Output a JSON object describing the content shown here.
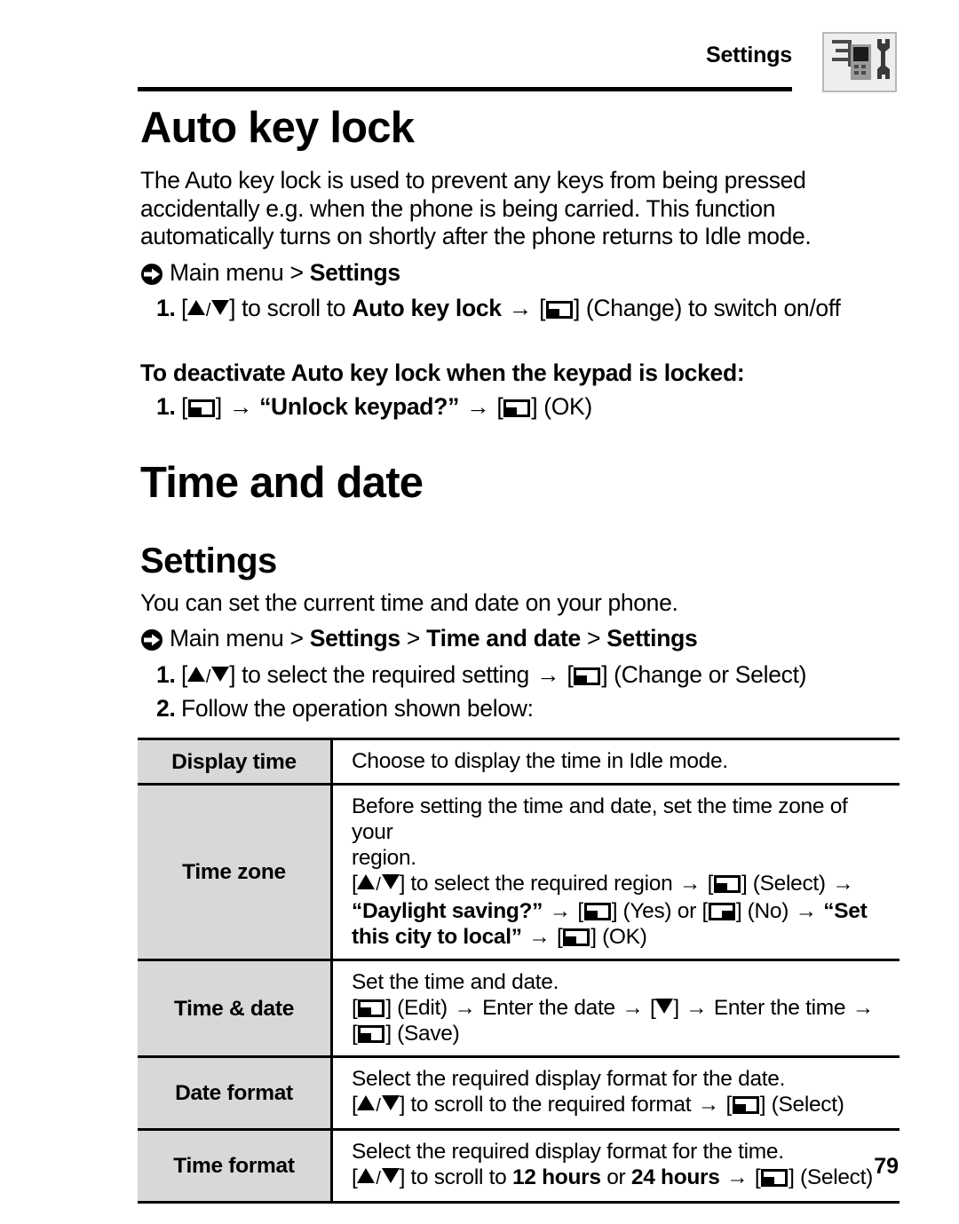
{
  "running_head": {
    "title": "Settings",
    "chapter_icon": "settings-tools-icon"
  },
  "sections": [
    {
      "heading": "Auto key lock",
      "intro": "The Auto key lock is used to prevent any keys from being pressed accidentally e.g. when the phone is being carried. This function automatically turns on shortly after the phone returns to Idle mode.",
      "nav_prefix": "Main menu > ",
      "nav_bold": "Settings",
      "step1_num": "1.",
      "step1_a": " to scroll to ",
      "step1_bold": "Auto key lock",
      "step1_b": " (Change) to switch on/off",
      "deactivate_heading": "To deactivate Auto key lock when the keypad is locked:",
      "deactivate_num": "1.",
      "deactivate_quote": "“Unlock keypad?”",
      "deactivate_tail": " (OK)"
    },
    {
      "heading": "Time and date",
      "subheading": "Settings",
      "intro": "You can set the current time and date on your phone.",
      "nav_prefix": "Main menu > ",
      "nav_b1": "Settings",
      "nav_sep1": " > ",
      "nav_b2": "Time and date",
      "nav_sep2": " > ",
      "nav_b3": "Settings",
      "step1_num": "1.",
      "step1_a": " to select the required setting ",
      "step1_b": " (Change or Select)",
      "step2_num": "2.",
      "step2_text": "Follow the operation shown below:"
    }
  ],
  "table": {
    "rows": [
      {
        "key": "Display time",
        "lines": [
          {
            "text": "Choose to display the time in Idle mode."
          }
        ]
      },
      {
        "key": "Time zone",
        "lines": [
          {
            "text": "Before setting the time and date, set the time zone of your"
          },
          {
            "text": "region."
          },
          {
            "a": " to select the required region ",
            "b": " (Select) "
          },
          {
            "quote": "“Daylight saving?”",
            "yes": " (Yes) or ",
            "no": " (No) ",
            "set_bold": "“Set"
          },
          {
            "bold_tail": "this city to local”",
            "ok": " (OK)"
          }
        ]
      },
      {
        "key": "Time & date",
        "lines": [
          {
            "text": "Set the time and date."
          },
          {
            "edit": " (Edit) ",
            "mid": " Enter the date ",
            "tail": " Enter the time "
          },
          {
            "save": " (Save)"
          }
        ]
      },
      {
        "key": "Date format",
        "lines": [
          {
            "text": "Select the required display format for the date."
          },
          {
            "a": " to scroll to the required format ",
            "b": " (Select)"
          }
        ]
      },
      {
        "key": "Time format",
        "lines": [
          {
            "text": "Select the required display format for the time."
          },
          {
            "a": " to scroll to ",
            "b1": "12 hours",
            "mid": " or ",
            "b2": "24 hours",
            "tail": " (Select)"
          }
        ]
      }
    ]
  },
  "folio": "79"
}
